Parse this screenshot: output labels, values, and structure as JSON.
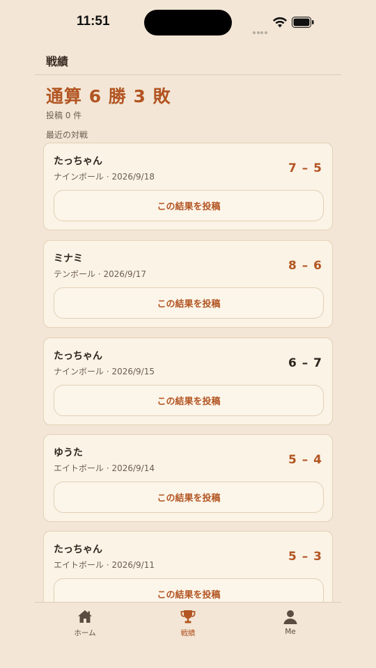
{
  "status_bar": {
    "time": "11:51"
  },
  "header": {
    "title": "戦績"
  },
  "summary": {
    "title": "通算 6 勝 3 敗",
    "subtitle": "投稿 0 件"
  },
  "section_label": "最近の対戦",
  "matches": [
    {
      "opponent": "たっちゃん",
      "meta": "ナインボール · 2026/9/18",
      "score": "7 – 5",
      "button": "この結果を投稿"
    },
    {
      "opponent": "ミナミ",
      "meta": "テンボール · 2026/9/17",
      "score": "8 – 6",
      "button": "この結果を投稿"
    },
    {
      "opponent": "たっちゃん",
      "meta": "ナインボール · 2026/9/15",
      "score": "6 – 7",
      "button": "この結果を投稿"
    },
    {
      "opponent": "ゆうた",
      "meta": "エイトボール · 2026/9/14",
      "score": "5 – 4",
      "button": "この結果を投稿"
    },
    {
      "opponent": "たっちゃん",
      "meta": "エイトボール · 2026/9/11",
      "score": "5 – 3",
      "button": "この結果を投稿"
    }
  ],
  "tabs": [
    {
      "label": "ホーム",
      "icon": "house-icon"
    },
    {
      "label": "戦績",
      "icon": "trophy-icon"
    },
    {
      "label": "Me",
      "icon": "person-icon"
    }
  ],
  "colors": {
    "accent": "#b25522",
    "background": "#f3e6d6",
    "card": "#fbf3e6"
  }
}
